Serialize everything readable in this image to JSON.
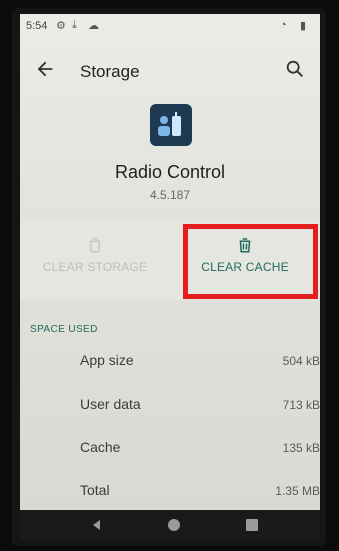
{
  "status_bar": {
    "time": "5:54"
  },
  "app_bar": {
    "title": "Storage"
  },
  "app_info": {
    "name": "Radio Control",
    "version": "4.5.187"
  },
  "actions": {
    "clear_storage_label": "CLEAR STORAGE",
    "clear_cache_label": "CLEAR CACHE"
  },
  "space_used": {
    "header": "SPACE USED",
    "rows": [
      {
        "label": "App size",
        "value": "504 kB"
      },
      {
        "label": "User data",
        "value": "713 kB"
      },
      {
        "label": "Cache",
        "value": "135 kB"
      },
      {
        "label": "Total",
        "value": "1.35 MB"
      }
    ]
  },
  "colors": {
    "accent": "#1f6b5c",
    "highlight": "#e41e1e",
    "app_icon_bg": "#1e3a52"
  },
  "icons": [
    "back-icon",
    "search-icon",
    "trash-icon",
    "nav-back-icon",
    "nav-home-icon",
    "nav-recents-icon"
  ]
}
